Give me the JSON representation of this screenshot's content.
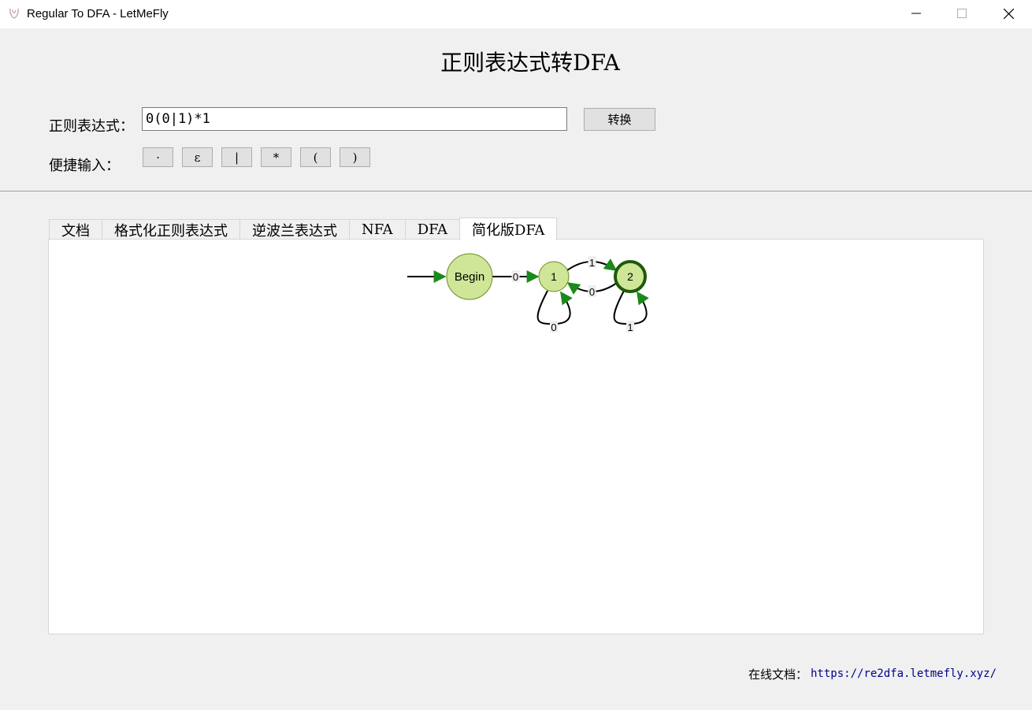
{
  "window": {
    "title": "Regular To DFA - LetMeFly",
    "controls": [
      "minimize-icon",
      "maximize-icon",
      "close-icon"
    ]
  },
  "header": {
    "title": "正则表达式转DFA"
  },
  "regex": {
    "label": "正则表达式：",
    "value": "0(0|1)*1",
    "convert_label": "转换"
  },
  "quick_input": {
    "label": "便捷输入：",
    "buttons": [
      "·",
      "ε",
      "|",
      "*",
      "(",
      ")"
    ]
  },
  "tabs": [
    "文档",
    "格式化正则表达式",
    "逆波兰表达式",
    "NFA",
    "DFA",
    "简化版DFA"
  ],
  "active_tab": "简化版DFA",
  "graph": {
    "nodes": [
      {
        "id": "Begin",
        "label": "Begin",
        "accepting": false,
        "start": true
      },
      {
        "id": "1",
        "label": "1",
        "accepting": false
      },
      {
        "id": "2",
        "label": "2",
        "accepting": true
      }
    ],
    "edges": [
      {
        "from": "Begin",
        "to": "1",
        "label": "0"
      },
      {
        "from": "1",
        "to": "2",
        "label": "1"
      },
      {
        "from": "2",
        "to": "1",
        "label": "0"
      },
      {
        "from": "1",
        "to": "1",
        "label": "0"
      },
      {
        "from": "2",
        "to": "2",
        "label": "1"
      }
    ],
    "colors": {
      "node_fill": "#cfe597",
      "node_stroke": "#6b8e23",
      "accept_stroke": "#1e5a0a",
      "arrow": "#1a8a1a"
    }
  },
  "footer": {
    "label": "在线文档：",
    "link": "https://re2dfa.letmefly.xyz/"
  }
}
